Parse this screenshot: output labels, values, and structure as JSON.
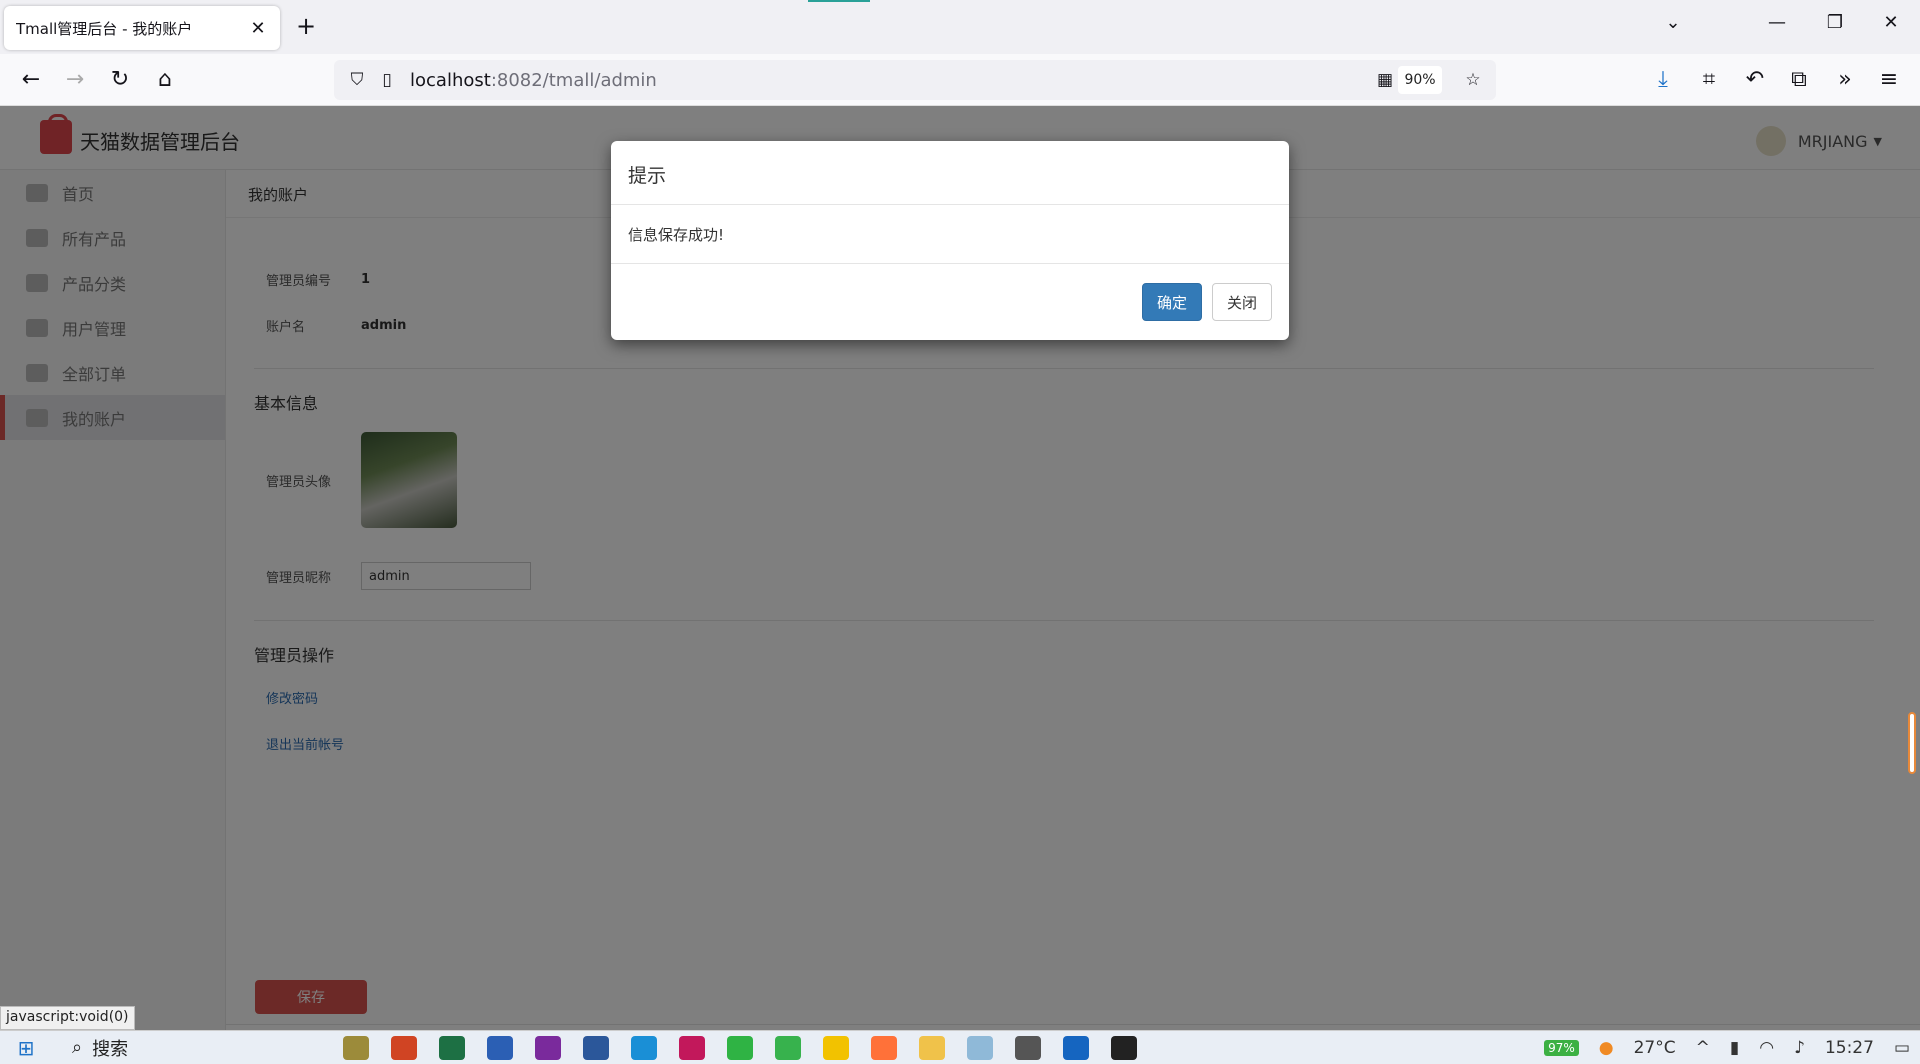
{
  "browser": {
    "tab_title": "Tmall管理后台 - 我的账户",
    "url_host": "localhost",
    "url_rest": ":8082/tmall/admin",
    "zoom": "90%"
  },
  "app": {
    "brand": "天猫数据管理后台",
    "user": "MRJIANG"
  },
  "sidebar": {
    "items": [
      {
        "label": "首页"
      },
      {
        "label": "所有产品"
      },
      {
        "label": "产品分类"
      },
      {
        "label": "用户管理"
      },
      {
        "label": "全部订单"
      },
      {
        "label": "我的账户"
      }
    ]
  },
  "main": {
    "breadcrumb": "我的账户",
    "admin_id_label": "管理员编号",
    "admin_id_value": "1",
    "account_label": "账户名",
    "account_value": "admin",
    "basic_info_title": "基本信息",
    "avatar_label": "管理员头像",
    "nickname_label": "管理员昵称",
    "nickname_value": "admin",
    "ops_title": "管理员操作",
    "change_password": "修改密码",
    "logout": "退出当前帐号",
    "save_label": "保存"
  },
  "modal": {
    "title": "提示",
    "message": "信息保存成功!",
    "confirm_label": "确定",
    "close_label": "关闭"
  },
  "status_link": "javascript:void(0)",
  "taskbar": {
    "search_label": "搜索",
    "weather": "27°C",
    "battery": "97%",
    "time": "15:27"
  }
}
